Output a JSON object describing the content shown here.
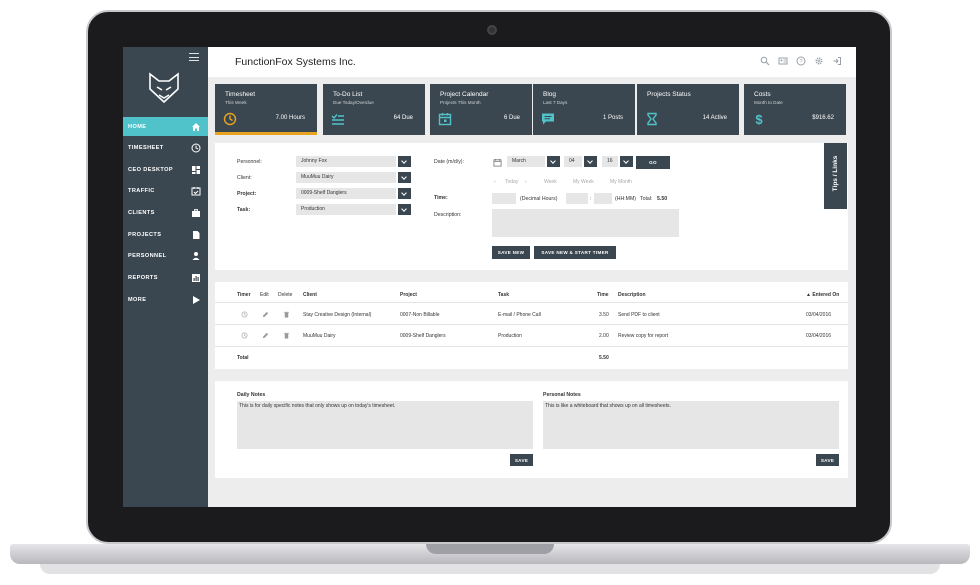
{
  "app": {
    "company": "FunctionFox Systems Inc.",
    "tips_label": "Tips / Links"
  },
  "sidebar": {
    "items": [
      {
        "label": "HOME",
        "icon": "home-icon"
      },
      {
        "label": "TIMESHEET",
        "icon": "clock-icon"
      },
      {
        "label": "CEO DESKTOP",
        "icon": "dashboard-icon"
      },
      {
        "label": "TRAFFIC",
        "icon": "calendar-check-icon"
      },
      {
        "label": "CLIENTS",
        "icon": "briefcase-icon"
      },
      {
        "label": "PROJECTS",
        "icon": "document-icon"
      },
      {
        "label": "PERSONNEL",
        "icon": "person-icon"
      },
      {
        "label": "REPORTS",
        "icon": "bar-chart-icon"
      },
      {
        "label": "MORE",
        "icon": "play-icon"
      }
    ]
  },
  "cards": [
    {
      "title": "Timesheet",
      "subtitle": "This Week",
      "value": "7.00 Hours"
    },
    {
      "title": "To-Do List",
      "subtitle": "Due Today/Overdue",
      "value": "64 Due"
    },
    {
      "title": "Project Calendar",
      "subtitle": "Projects This Month",
      "value": "6 Due"
    },
    {
      "title": "Blog",
      "subtitle": "Last 7 Days",
      "value": "1 Posts"
    },
    {
      "title": "Projects Status",
      "subtitle": "",
      "value": "14 Active"
    },
    {
      "title": "Costs",
      "subtitle": "Month to Date",
      "value": "$916.62"
    }
  ],
  "entry": {
    "personnel_label": "Personnel:",
    "personnel_value": "Johnny Fox",
    "client_label": "Client:",
    "client_value": "MuuMuu Dairy",
    "project_label": "Project:",
    "project_value": "0009-Shelf Danglers",
    "task_label": "Task:",
    "task_value": "Production",
    "date_label": "Date (m/d/y):",
    "month_value": "March",
    "day_value": "04",
    "year_value": "16",
    "go_label": "GO",
    "quick_today": "Today",
    "quick_week": "Week",
    "quick_myweek": "My Week",
    "quick_mymonth": "My Month",
    "time_label": "Time:",
    "decimal_hours": "(Decimal Hours)",
    "colon": ":",
    "hhmm": "(HH:MM)",
    "total_label": "Total:",
    "total_value": "5.50",
    "description_label": "Description:",
    "save_new_label": "SAVE NEW",
    "save_new_start_label": "SAVE NEW & START TIMER"
  },
  "table": {
    "headers": {
      "timer": "Timer",
      "edit": "Edit",
      "delete": "Delete",
      "client": "Client",
      "project": "Project",
      "task": "Task",
      "time": "Time",
      "description": "Description",
      "entered_on": "▲ Entered On"
    },
    "rows": [
      {
        "client": "Stay Creative Design (Internal)",
        "project": "0007-Non Billable",
        "task": "E-mail / Phone Call",
        "time": "3.50",
        "description": "Send PDF to client",
        "entered_on": "03/04/2016"
      },
      {
        "client": "MuuMuu Dairy",
        "project": "0009-Shelf Danglers",
        "task": "Production",
        "time": "2.00",
        "description": "Review copy for report",
        "entered_on": "03/04/2016"
      }
    ],
    "total_label": "Total",
    "total_value": "5.50"
  },
  "notes": {
    "daily_title": "Daily Notes",
    "daily_text": "This is for daily specific notes that only shows up on today's timesheet.",
    "personal_title": "Personal Notes",
    "personal_text": "This is like a whiteboard that shows up on all timesheets.",
    "save_label": "SAVE"
  },
  "colors": {
    "sidebar": "#3b4750",
    "accent": "#4fc3c9",
    "highlight": "#e8a321"
  }
}
